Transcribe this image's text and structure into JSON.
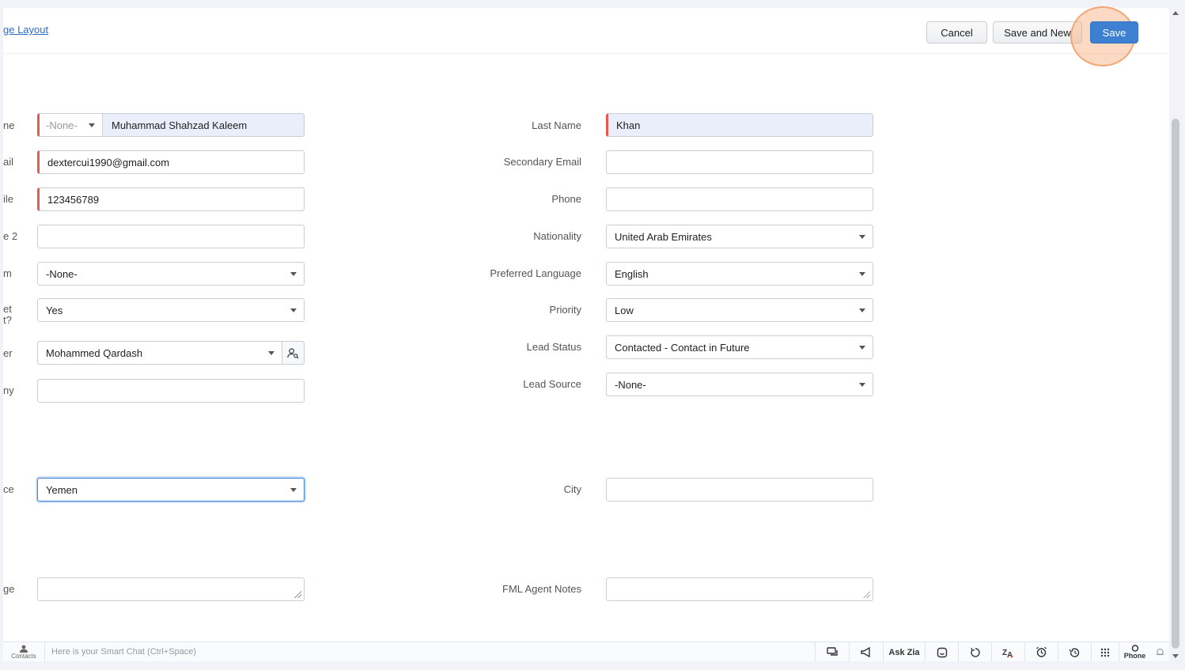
{
  "header": {
    "layout_link": "ge Layout",
    "cancel_label": "Cancel",
    "save_new_label": "Save and New",
    "save_label": "Save"
  },
  "left_fields": [
    {
      "label": "ne",
      "salutation": "-None-",
      "value": "Muhammad Shahzad Kaleem"
    },
    {
      "label": "ail",
      "value": "dextercui1990@gmail.com"
    },
    {
      "label": "ile",
      "value": "123456789"
    },
    {
      "label": "e 2",
      "value": ""
    },
    {
      "label": "m",
      "value": "-None-"
    },
    {
      "label_line1": "et",
      "label_line2": "t?",
      "value": "Yes"
    },
    {
      "label": "er",
      "value": "Mohammed Qardash"
    },
    {
      "label": "ny",
      "value": ""
    },
    {
      "label": "ce",
      "value": "Yemen"
    },
    {
      "label": "ge",
      "value": ""
    }
  ],
  "right_fields": [
    {
      "label": "Last Name",
      "value": "Khan"
    },
    {
      "label": "Secondary Email",
      "value": ""
    },
    {
      "label": "Phone",
      "value": ""
    },
    {
      "label": "Nationality",
      "value": "United Arab Emirates"
    },
    {
      "label": "Preferred Language",
      "value": "English"
    },
    {
      "label": "Priority",
      "value": "Low"
    },
    {
      "label": "Lead Status",
      "value": "Contacted - Contact in Future"
    },
    {
      "label": "Lead Source",
      "value": "-None-"
    },
    {
      "label": "City",
      "value": ""
    },
    {
      "label": "FML Agent Notes",
      "value": ""
    }
  ],
  "footer": {
    "contacts_label": "Contacts",
    "chat_placeholder": "Here is your Smart Chat (Ctrl+Space)",
    "ask_zia": "Ask Zia",
    "phone": "Phone"
  }
}
